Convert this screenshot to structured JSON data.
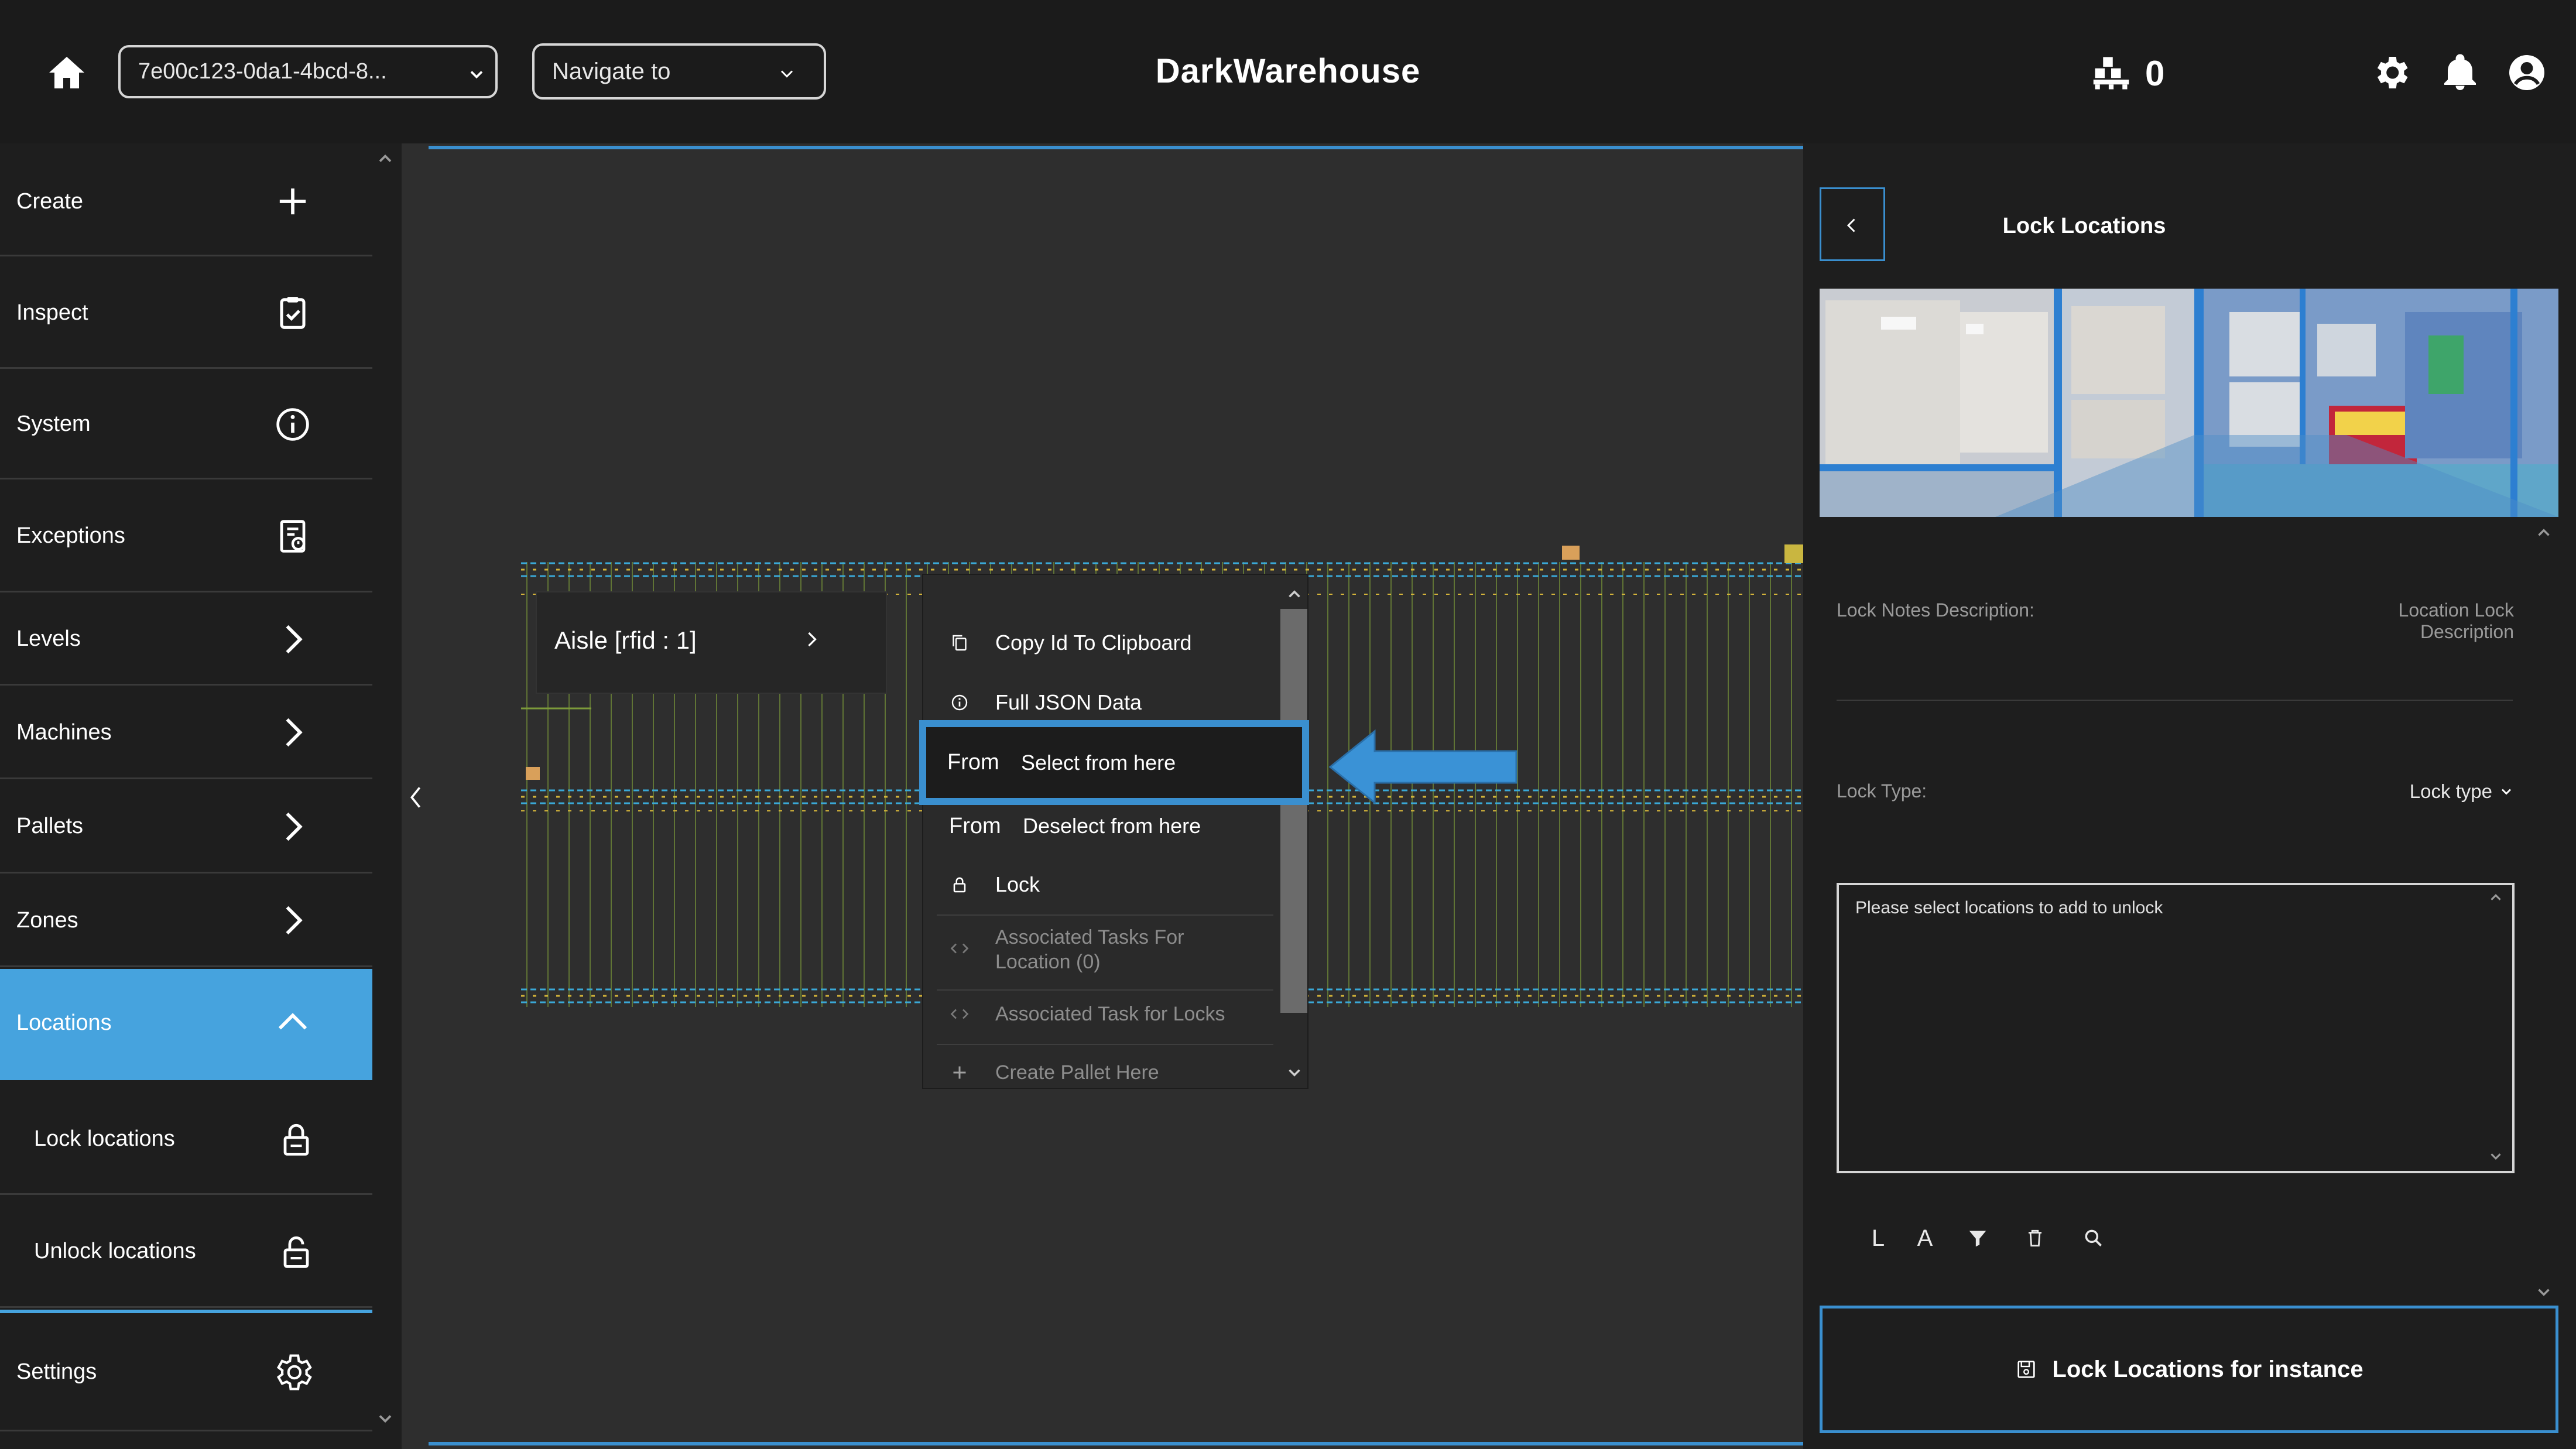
{
  "header": {
    "instance_id": "7e00c123-0da1-4bcd-8...",
    "navigate_placeholder": "Navigate to",
    "app_title": "DarkWarehouse",
    "pallet_count": "0"
  },
  "sidebar": {
    "items": [
      {
        "label": "Create",
        "icon": "plus-icon"
      },
      {
        "label": "Inspect",
        "icon": "clipboard-check-icon"
      },
      {
        "label": "System",
        "icon": "info-icon"
      },
      {
        "label": "Exceptions",
        "icon": "document-alert-icon"
      },
      {
        "label": "Levels",
        "icon": "chevron-right-icon"
      },
      {
        "label": "Machines",
        "icon": "chevron-right-icon"
      },
      {
        "label": "Pallets",
        "icon": "chevron-right-icon"
      },
      {
        "label": "Zones",
        "icon": "chevron-right-icon"
      },
      {
        "label": "Locations",
        "icon": "chevron-up-icon",
        "active": true
      },
      {
        "label": "Lock locations",
        "icon": "lock-icon"
      },
      {
        "label": "Unlock locations",
        "icon": "unlock-icon"
      },
      {
        "label": "Settings",
        "icon": "gear-icon"
      }
    ]
  },
  "map": {
    "aisle_label": "Aisle [rfid : 1]"
  },
  "context_menu": {
    "items": [
      {
        "label": "Copy Id To Clipboard",
        "icon": "copy-icon"
      },
      {
        "label": "Full JSON Data",
        "icon": "info-icon"
      },
      {
        "prefix": "From",
        "label": "Select from here",
        "highlighted": true
      },
      {
        "prefix": "From",
        "label": "Deselect from here"
      },
      {
        "label": "Lock",
        "icon": "lock-icon"
      },
      {
        "label": "Associated Tasks For Location (0)",
        "icon": "code-icon",
        "disabled": true
      },
      {
        "label": "Associated Task for Locks",
        "icon": "code-icon",
        "disabled": true
      },
      {
        "label": "Create Pallet Here",
        "icon": "plus-icon",
        "disabled": true
      }
    ]
  },
  "right_panel": {
    "title": "Lock Locations",
    "lock_notes_label": "Lock Notes Description:",
    "lock_notes_placeholder": "Location Lock Description",
    "lock_type_label": "Lock Type:",
    "lock_type_value": "Lock type",
    "locations_placeholder": "Please select locations to add to unlock",
    "toolbar": {
      "l": "L",
      "a": "A"
    },
    "submit_label": "Lock Locations for instance"
  },
  "colors": {
    "accent": "#46a3de",
    "highlight_border": "#3a8fcf",
    "topbar_bg": "#1b1b1b",
    "panel_bg": "#1e1e1e",
    "canvas_bg": "#2e2e2e"
  }
}
